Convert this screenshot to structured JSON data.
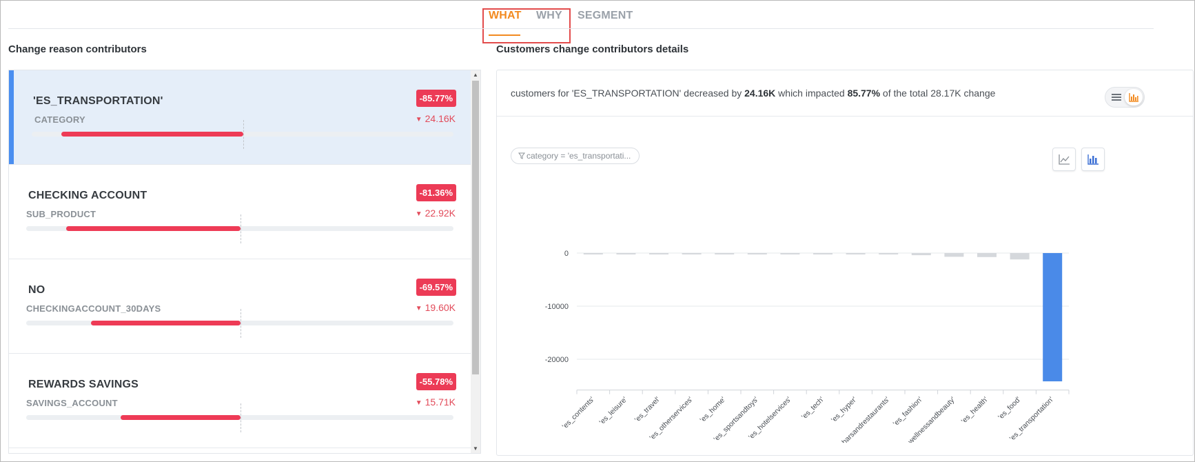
{
  "tabs": [
    {
      "label": "WHAT",
      "active": true
    },
    {
      "label": "WHY",
      "active": false
    },
    {
      "label": "SEGMENT",
      "active": false
    }
  ],
  "left": {
    "title": "Change reason contributors",
    "cards": [
      {
        "name": "'ES_TRANSPORTATION'",
        "type": "CATEGORY",
        "pct": "-85.77%",
        "delta": "24.16K",
        "fill": 0.4277,
        "selected": true
      },
      {
        "name": "CHECKING ACCOUNT",
        "type": "SUB_PRODUCT",
        "pct": "-81.36%",
        "delta": "22.92K",
        "fill": 0.4056,
        "selected": false
      },
      {
        "name": "NO",
        "type": "CHECKINGACCOUNT_30DAYS",
        "pct": "-69.57%",
        "delta": "19.60K",
        "fill": 0.3468,
        "selected": false
      },
      {
        "name": "REWARDS SAVINGS",
        "type": "SAVINGS_ACCOUNT",
        "pct": "-55.78%",
        "delta": "15.71K",
        "fill": 0.2781,
        "selected": false
      }
    ]
  },
  "right": {
    "title": "Customers change contributors details",
    "summary": {
      "prefix": "customers for 'ES_TRANSPORTATION' decreased by ",
      "amount": "24.16K",
      "middle": " which impacted ",
      "pct": "85.77%",
      "suffix": " of the total 28.17K change"
    },
    "filter": "category = 'es_transportati...",
    "icons": {
      "view_list": "list-icon",
      "view_chart": "bar-chart-icon",
      "line": "line-chart-icon",
      "bar": "bar-chart-icon",
      "filter": "filter-icon"
    },
    "colors": {
      "accent": "#f28a1f",
      "bar_highlight": "#4a8ae8",
      "bar_other": "#d5d8dc",
      "badge": "#ec3b56"
    }
  },
  "chart_data": {
    "type": "bar",
    "categories": [
      "'es_contents'",
      "'es_leisure'",
      "'es_travel'",
      "'es_otherservices'",
      "'es_home'",
      "'es_sportsandtoys'",
      "'es_hotelservices'",
      "'es_tech'",
      "'es_hyper'",
      "'es_barsandrestaurants'",
      "'es_fashion'",
      "'es_wellnessandbeauty'",
      "'es_health'",
      "'es_food'",
      "'es_transportation'"
    ],
    "values": [
      -260,
      -260,
      -260,
      -260,
      -260,
      -260,
      -260,
      -260,
      -260,
      -260,
      -400,
      -700,
      -750,
      -1200,
      -24160
    ],
    "highlight_index": 14,
    "yticks": [
      0,
      -10000,
      -20000
    ],
    "ytick_labels": [
      "0",
      "-10000",
      "-20000"
    ],
    "ylim": [
      -25800,
      0
    ],
    "grid": true,
    "title": "",
    "xlabel": "",
    "ylabel": ""
  }
}
